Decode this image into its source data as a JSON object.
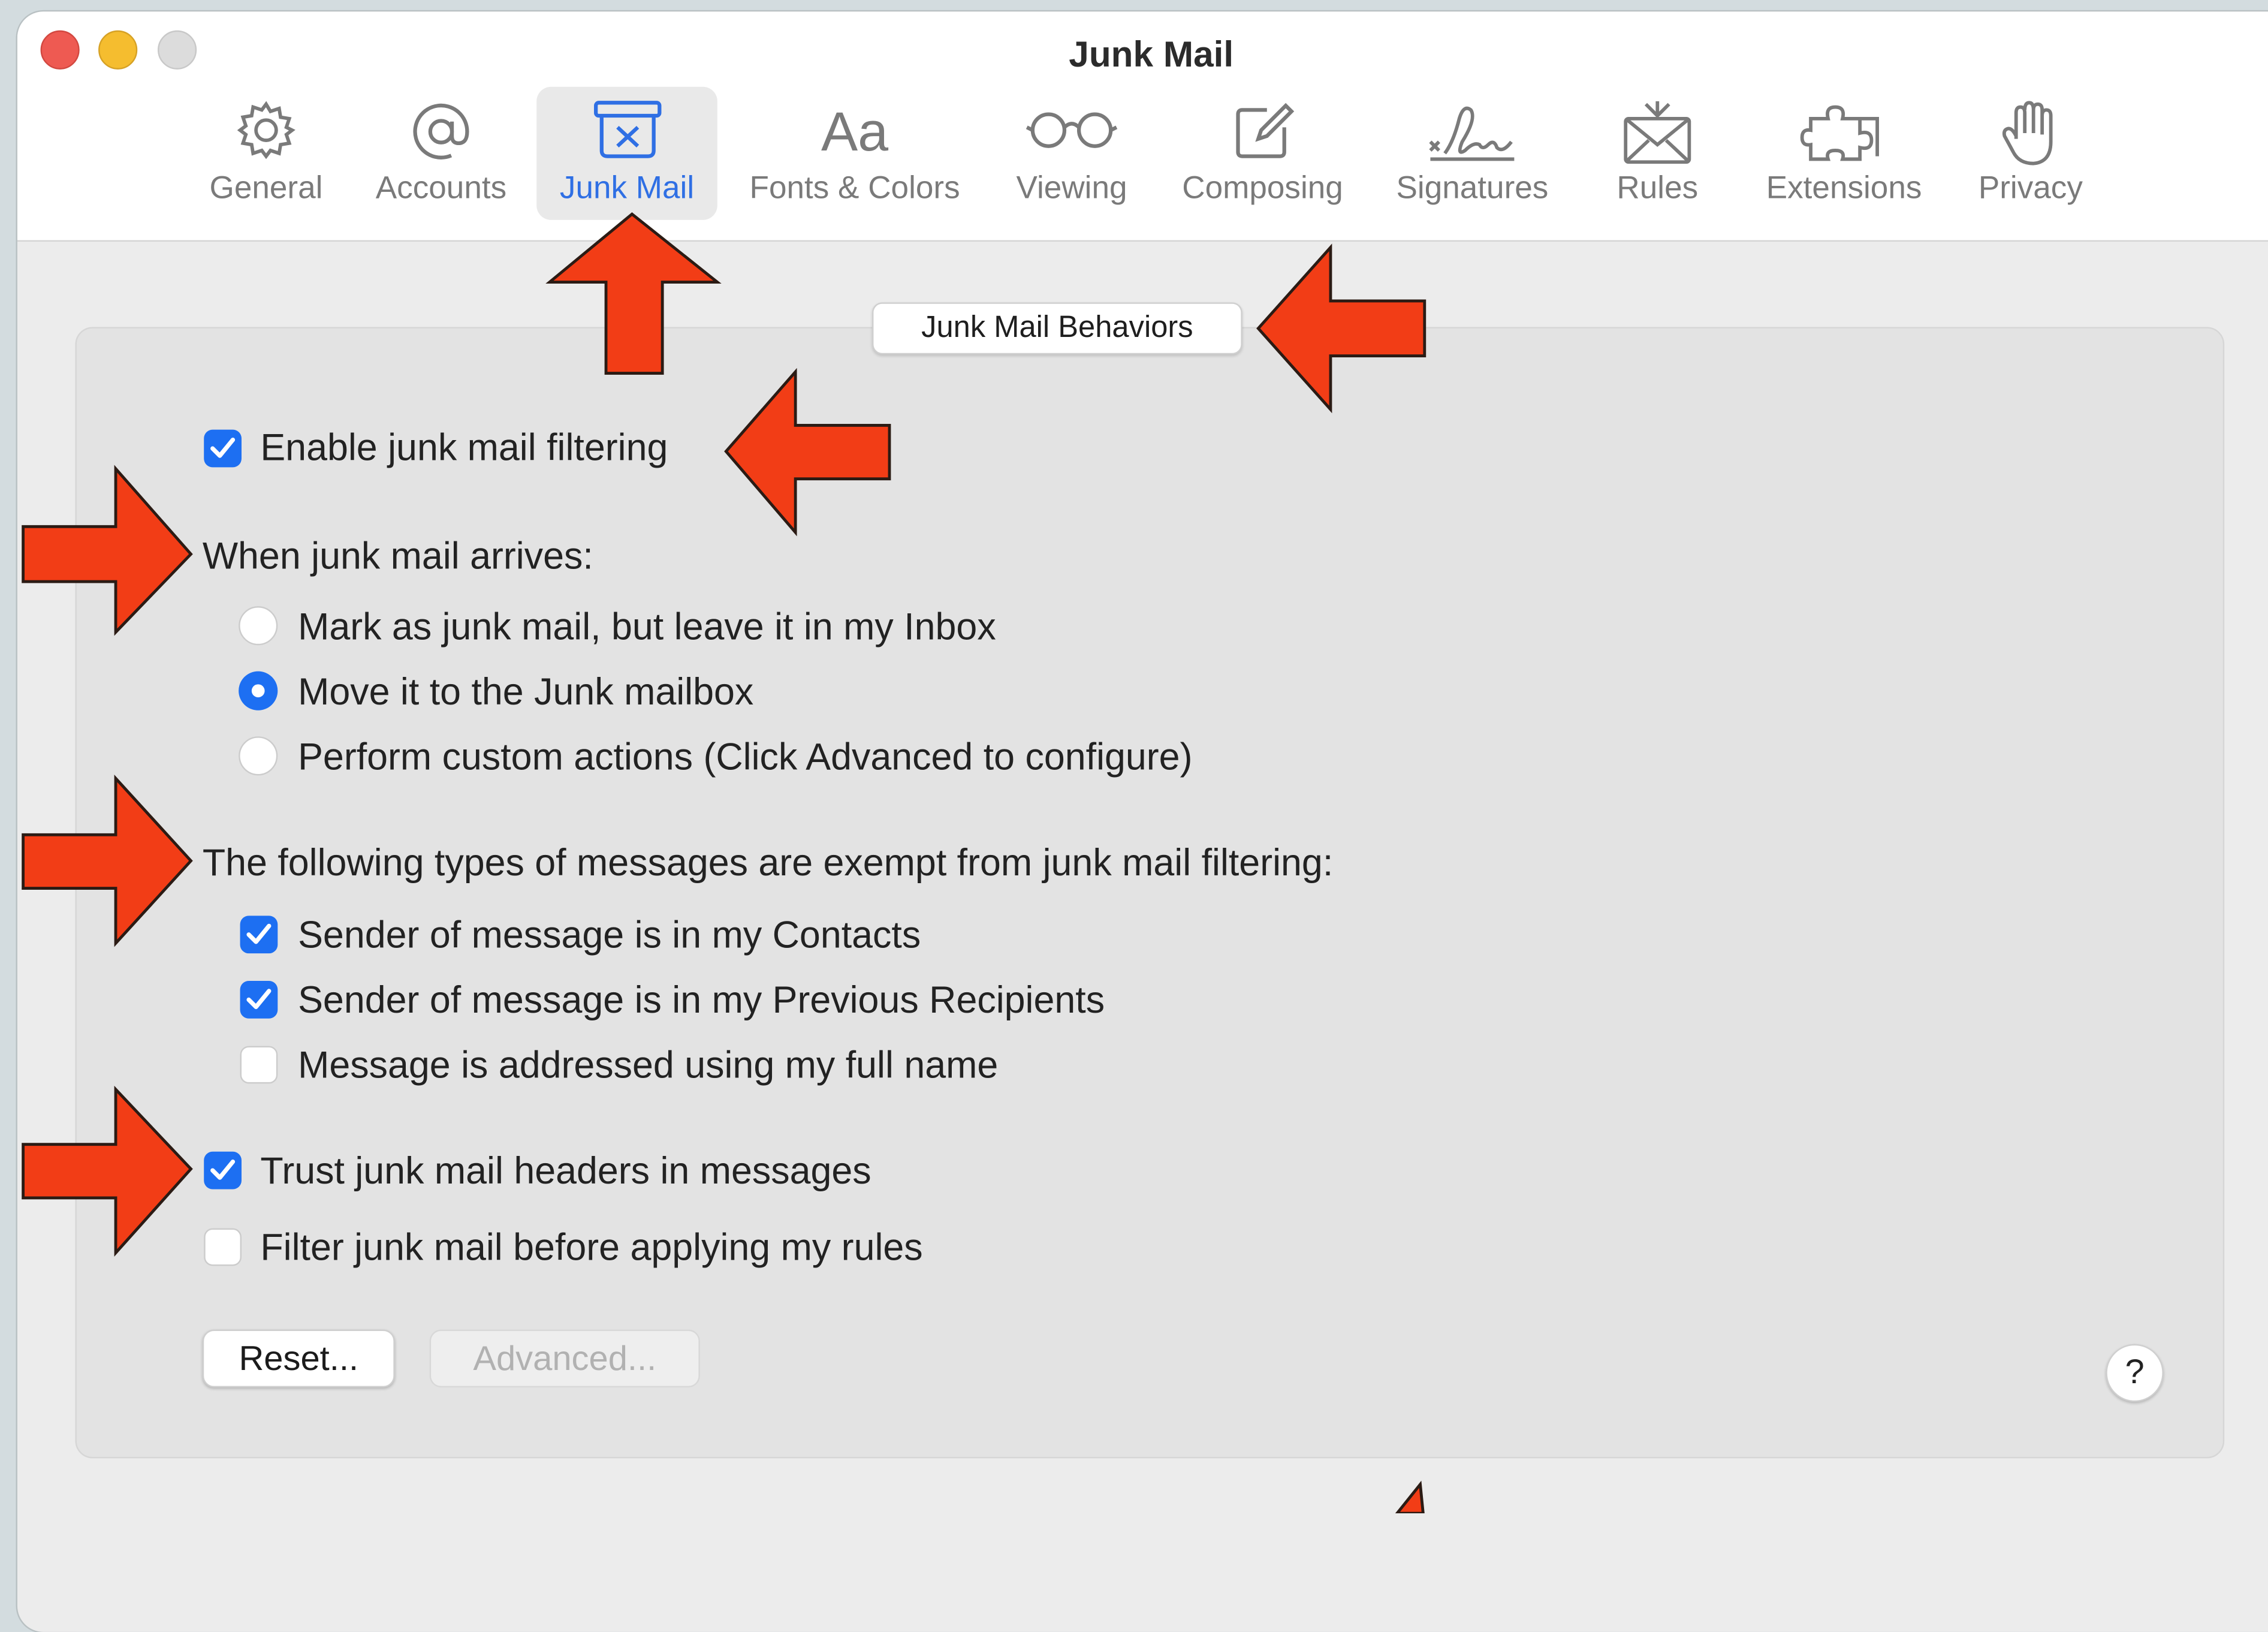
{
  "window": {
    "title": "Junk Mail"
  },
  "toolbar": {
    "tabs": [
      {
        "label": "General",
        "icon": "gear-icon"
      },
      {
        "label": "Accounts",
        "icon": "at-sign-icon"
      },
      {
        "label": "Junk Mail",
        "icon": "junk-bin-icon",
        "active": true
      },
      {
        "label": "Fonts & Colors",
        "icon": "text-aa-icon"
      },
      {
        "label": "Viewing",
        "icon": "glasses-icon"
      },
      {
        "label": "Composing",
        "icon": "compose-icon"
      },
      {
        "label": "Signatures",
        "icon": "signature-icon"
      },
      {
        "label": "Rules",
        "icon": "envelope-rules-icon"
      },
      {
        "label": "Extensions",
        "icon": "puzzle-icon"
      },
      {
        "label": "Privacy",
        "icon": "hand-icon"
      }
    ]
  },
  "section": {
    "title": "Junk Mail Behaviors",
    "enable_filtering": {
      "label": "Enable junk mail filtering",
      "checked": true
    },
    "arrives_heading": "When junk mail arrives:",
    "arrive_options": [
      {
        "label": "Mark as junk mail, but leave it in my Inbox",
        "selected": false
      },
      {
        "label": "Move it to the Junk mailbox",
        "selected": true
      },
      {
        "label": "Perform custom actions (Click Advanced to configure)",
        "selected": false
      }
    ],
    "exempt_heading": "The following types of messages are exempt from junk mail filtering:",
    "exempt_options": [
      {
        "label": "Sender of message is in my Contacts",
        "checked": true
      },
      {
        "label": "Sender of message is in my Previous Recipients",
        "checked": true
      },
      {
        "label": "Message is addressed using my full name",
        "checked": false
      }
    ],
    "trust_headers": {
      "label": "Trust junk mail headers in messages",
      "checked": true
    },
    "filter_before_rules": {
      "label": "Filter junk mail before applying my rules",
      "checked": false
    }
  },
  "buttons": {
    "reset": "Reset...",
    "advanced": "Advanced...",
    "help": "?"
  },
  "colors": {
    "accent": "#1d6ff2",
    "annotation_arrow": "#f23d16"
  }
}
